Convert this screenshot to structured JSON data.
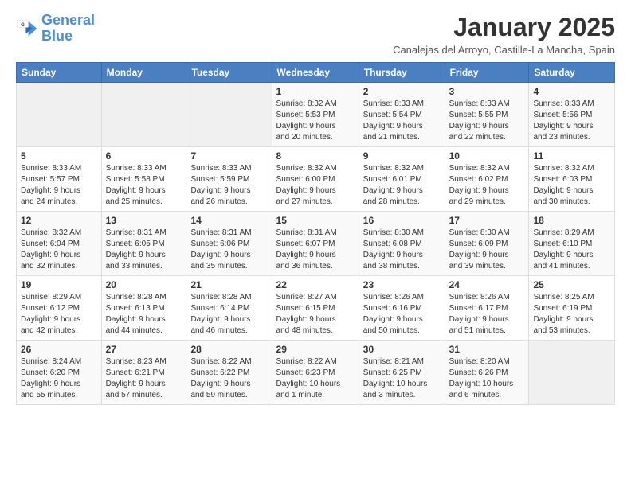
{
  "logo": {
    "line1": "General",
    "line2": "Blue"
  },
  "title": "January 2025",
  "subtitle": "Canalejas del Arroyo, Castille-La Mancha, Spain",
  "weekdays": [
    "Sunday",
    "Monday",
    "Tuesday",
    "Wednesday",
    "Thursday",
    "Friday",
    "Saturday"
  ],
  "weeks": [
    [
      {
        "day": "",
        "info": ""
      },
      {
        "day": "",
        "info": ""
      },
      {
        "day": "",
        "info": ""
      },
      {
        "day": "1",
        "info": "Sunrise: 8:32 AM\nSunset: 5:53 PM\nDaylight: 9 hours\nand 20 minutes."
      },
      {
        "day": "2",
        "info": "Sunrise: 8:33 AM\nSunset: 5:54 PM\nDaylight: 9 hours\nand 21 minutes."
      },
      {
        "day": "3",
        "info": "Sunrise: 8:33 AM\nSunset: 5:55 PM\nDaylight: 9 hours\nand 22 minutes."
      },
      {
        "day": "4",
        "info": "Sunrise: 8:33 AM\nSunset: 5:56 PM\nDaylight: 9 hours\nand 23 minutes."
      }
    ],
    [
      {
        "day": "5",
        "info": "Sunrise: 8:33 AM\nSunset: 5:57 PM\nDaylight: 9 hours\nand 24 minutes."
      },
      {
        "day": "6",
        "info": "Sunrise: 8:33 AM\nSunset: 5:58 PM\nDaylight: 9 hours\nand 25 minutes."
      },
      {
        "day": "7",
        "info": "Sunrise: 8:33 AM\nSunset: 5:59 PM\nDaylight: 9 hours\nand 26 minutes."
      },
      {
        "day": "8",
        "info": "Sunrise: 8:32 AM\nSunset: 6:00 PM\nDaylight: 9 hours\nand 27 minutes."
      },
      {
        "day": "9",
        "info": "Sunrise: 8:32 AM\nSunset: 6:01 PM\nDaylight: 9 hours\nand 28 minutes."
      },
      {
        "day": "10",
        "info": "Sunrise: 8:32 AM\nSunset: 6:02 PM\nDaylight: 9 hours\nand 29 minutes."
      },
      {
        "day": "11",
        "info": "Sunrise: 8:32 AM\nSunset: 6:03 PM\nDaylight: 9 hours\nand 30 minutes."
      }
    ],
    [
      {
        "day": "12",
        "info": "Sunrise: 8:32 AM\nSunset: 6:04 PM\nDaylight: 9 hours\nand 32 minutes."
      },
      {
        "day": "13",
        "info": "Sunrise: 8:31 AM\nSunset: 6:05 PM\nDaylight: 9 hours\nand 33 minutes."
      },
      {
        "day": "14",
        "info": "Sunrise: 8:31 AM\nSunset: 6:06 PM\nDaylight: 9 hours\nand 35 minutes."
      },
      {
        "day": "15",
        "info": "Sunrise: 8:31 AM\nSunset: 6:07 PM\nDaylight: 9 hours\nand 36 minutes."
      },
      {
        "day": "16",
        "info": "Sunrise: 8:30 AM\nSunset: 6:08 PM\nDaylight: 9 hours\nand 38 minutes."
      },
      {
        "day": "17",
        "info": "Sunrise: 8:30 AM\nSunset: 6:09 PM\nDaylight: 9 hours\nand 39 minutes."
      },
      {
        "day": "18",
        "info": "Sunrise: 8:29 AM\nSunset: 6:10 PM\nDaylight: 9 hours\nand 41 minutes."
      }
    ],
    [
      {
        "day": "19",
        "info": "Sunrise: 8:29 AM\nSunset: 6:12 PM\nDaylight: 9 hours\nand 42 minutes."
      },
      {
        "day": "20",
        "info": "Sunrise: 8:28 AM\nSunset: 6:13 PM\nDaylight: 9 hours\nand 44 minutes."
      },
      {
        "day": "21",
        "info": "Sunrise: 8:28 AM\nSunset: 6:14 PM\nDaylight: 9 hours\nand 46 minutes."
      },
      {
        "day": "22",
        "info": "Sunrise: 8:27 AM\nSunset: 6:15 PM\nDaylight: 9 hours\nand 48 minutes."
      },
      {
        "day": "23",
        "info": "Sunrise: 8:26 AM\nSunset: 6:16 PM\nDaylight: 9 hours\nand 50 minutes."
      },
      {
        "day": "24",
        "info": "Sunrise: 8:26 AM\nSunset: 6:17 PM\nDaylight: 9 hours\nand 51 minutes."
      },
      {
        "day": "25",
        "info": "Sunrise: 8:25 AM\nSunset: 6:19 PM\nDaylight: 9 hours\nand 53 minutes."
      }
    ],
    [
      {
        "day": "26",
        "info": "Sunrise: 8:24 AM\nSunset: 6:20 PM\nDaylight: 9 hours\nand 55 minutes."
      },
      {
        "day": "27",
        "info": "Sunrise: 8:23 AM\nSunset: 6:21 PM\nDaylight: 9 hours\nand 57 minutes."
      },
      {
        "day": "28",
        "info": "Sunrise: 8:22 AM\nSunset: 6:22 PM\nDaylight: 9 hours\nand 59 minutes."
      },
      {
        "day": "29",
        "info": "Sunrise: 8:22 AM\nSunset: 6:23 PM\nDaylight: 10 hours\nand 1 minute."
      },
      {
        "day": "30",
        "info": "Sunrise: 8:21 AM\nSunset: 6:25 PM\nDaylight: 10 hours\nand 3 minutes."
      },
      {
        "day": "31",
        "info": "Sunrise: 8:20 AM\nSunset: 6:26 PM\nDaylight: 10 hours\nand 6 minutes."
      },
      {
        "day": "",
        "info": ""
      }
    ]
  ]
}
